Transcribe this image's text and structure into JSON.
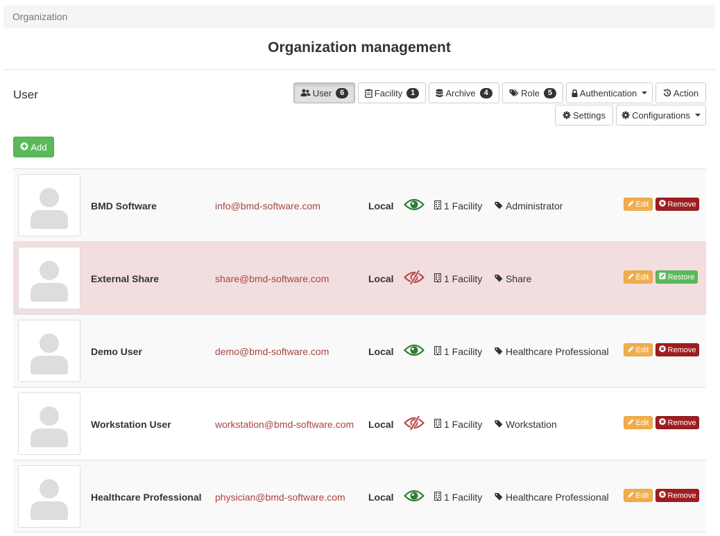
{
  "breadcrumb": {
    "label": "Organization"
  },
  "page": {
    "title": "Organization management",
    "section": "User"
  },
  "toolbar": {
    "user": {
      "label": "User",
      "count": "6"
    },
    "facility": {
      "label": "Facility",
      "count": "1"
    },
    "archive": {
      "label": "Archive",
      "count": "4"
    },
    "role": {
      "label": "Role",
      "count": "5"
    },
    "authentication": {
      "label": "Authentication"
    },
    "action": {
      "label": "Action"
    },
    "settings": {
      "label": "Settings"
    },
    "configurations": {
      "label": "Configurations"
    }
  },
  "add_button": {
    "label": "Add"
  },
  "users": [
    {
      "name": "BMD Software",
      "email": "info@bmd-software.com",
      "auth": "Local",
      "visibility": "visible",
      "facility": "1 Facility",
      "role": "Administrator",
      "edit": "Edit",
      "action": "Remove",
      "archived": false
    },
    {
      "name": "External Share",
      "email": "share@bmd-software.com",
      "auth": "Local",
      "visibility": "hidden",
      "facility": "1 Facility",
      "role": "Share",
      "edit": "Edit",
      "action": "Restore",
      "archived": true
    },
    {
      "name": "Demo User",
      "email": "demo@bmd-software.com",
      "auth": "Local",
      "visibility": "visible",
      "facility": "1 Facility",
      "role": "Healthcare Professional",
      "edit": "Edit",
      "action": "Remove",
      "archived": false
    },
    {
      "name": "Workstation User",
      "email": "workstation@bmd-software.com",
      "auth": "Local",
      "visibility": "hidden",
      "facility": "1 Facility",
      "role": "Workstation",
      "edit": "Edit",
      "action": "Remove",
      "archived": false
    },
    {
      "name": "Healthcare Professional",
      "email": "physician@bmd-software.com",
      "auth": "Local",
      "visibility": "visible",
      "facility": "1 Facility",
      "role": "Healthcare Professional",
      "edit": "Edit",
      "action": "Remove",
      "archived": false
    }
  ],
  "colors": {
    "accent_green": "#5cb85c",
    "danger": "#9f1d20",
    "warning": "#f0ad4e",
    "email": "#a94442",
    "eye_visible": "#2e7d32",
    "eye_hidden": "#b94a48",
    "archived_row": "#f2dede"
  },
  "icons": {
    "user_tab": "users-icon",
    "facility_tab": "clipboard-icon",
    "archive_tab": "database-icon",
    "role_tab": "tags-icon",
    "authentication": "lock-icon",
    "action": "history-icon",
    "settings": "gear-icon",
    "configurations": "gear-icon",
    "add": "plus-circle-icon",
    "avatar": "user-silhouette-icon",
    "visible": "eye-icon",
    "hidden": "eye-slash-icon",
    "facility": "building-icon",
    "role": "tag-icon",
    "edit": "pencil-icon",
    "remove": "times-circle-icon",
    "restore": "restore-icon"
  }
}
